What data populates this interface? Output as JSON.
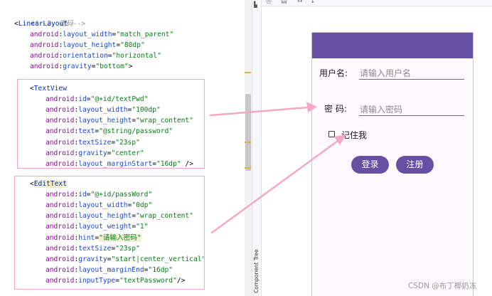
{
  "editor": {
    "comment": "<!--2. 密码-->",
    "linear_layout": {
      "open": "<",
      "tag": "LinearLayout",
      "attrs": [
        {
          "ns": "android",
          "name": "layout_width",
          "value": "\"match_parent\"",
          "end": ""
        },
        {
          "ns": "android",
          "name": "layout_height",
          "value": "\"80dp\"",
          "end": ""
        },
        {
          "ns": "android",
          "name": "orientation",
          "value": "\"horizontal\"",
          "end": ""
        },
        {
          "ns": "android",
          "name": "gravity",
          "value": "\"bottom\"",
          "end": ">"
        }
      ]
    },
    "text_view": {
      "open": "<",
      "tag": "TextView",
      "attrs": [
        {
          "ns": "android",
          "name": "id",
          "value": "\"@+id/textPwd\"",
          "end": ""
        },
        {
          "ns": "android",
          "name": "layout_width",
          "value": "\"100dp\"",
          "end": ""
        },
        {
          "ns": "android",
          "name": "layout_height",
          "value": "\"wrap_content\"",
          "end": ""
        },
        {
          "ns": "android",
          "name": "text",
          "value": "\"@string/password\"",
          "end": ""
        },
        {
          "ns": "android",
          "name": "textSize",
          "value": "\"23sp\"",
          "end": ""
        },
        {
          "ns": "android",
          "name": "gravity",
          "value": "\"center\"",
          "end": ""
        },
        {
          "ns": "android",
          "name": "layout_marginStart",
          "value": "\"16dp\"",
          "end": " />"
        }
      ]
    },
    "edit_text": {
      "open": "<",
      "tag": "EditText",
      "attrs": [
        {
          "ns": "android",
          "name": "id",
          "value": "\"@+id/passWord\"",
          "end": ""
        },
        {
          "ns": "android",
          "name": "layout_width",
          "value": "\"0dp\"",
          "end": ""
        },
        {
          "ns": "android",
          "name": "layout_height",
          "value": "\"wrap_content\"",
          "end": ""
        },
        {
          "ns": "android",
          "name": "layout_weight",
          "value": "\"1\"",
          "end": ""
        },
        {
          "ns": "android",
          "name": "hint",
          "value": "\"请输入密码\"",
          "end": ""
        },
        {
          "ns": "android",
          "name": "textSize",
          "value": "\"23sp\"",
          "end": ""
        },
        {
          "ns": "android",
          "name": "gravity",
          "value": "\"start|center_vertical\"",
          "end": ""
        },
        {
          "ns": "android",
          "name": "layout_marginEnd",
          "value": "\"16dp\"",
          "end": ""
        },
        {
          "ns": "android",
          "name": "inputType",
          "value": "\"textPassword\"",
          "end": "/>"
        }
      ]
    }
  },
  "sidebar": {
    "component_tree_label": "Component Tree"
  },
  "design_toolbar": {
    "icons": [
      "eye-icon",
      "layout-icon",
      "arrow-icon",
      "resize-icon"
    ]
  },
  "preview": {
    "username_label": "用户名:",
    "username_hint": "请输入用户名",
    "password_label": "密 码:",
    "password_hint": "请输入密码",
    "remember_label": "记住我",
    "remember_checked": false,
    "login_button": "登录",
    "register_button": "注册"
  },
  "colors": {
    "app_bar": "#6750a4",
    "button": "#6750a4",
    "annotation_arrow": "#f4a8c6"
  },
  "watermark": "CSDN @布丁椰奶冻"
}
